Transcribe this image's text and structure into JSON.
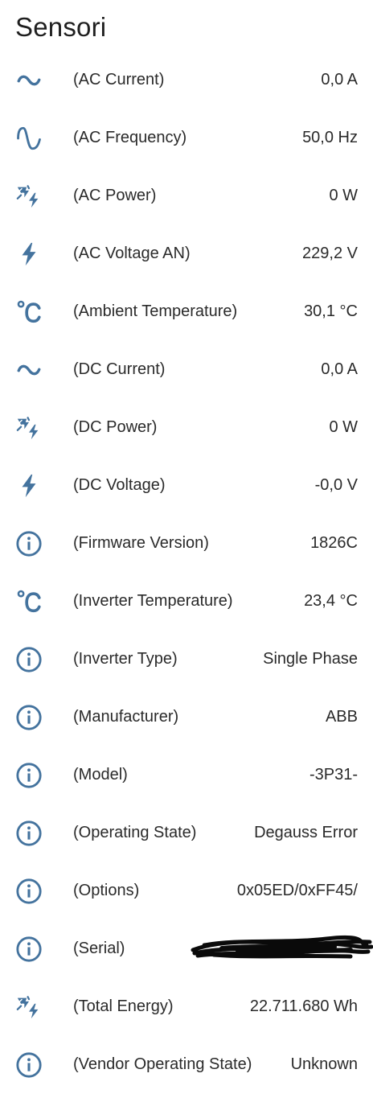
{
  "card": {
    "title": "Sensori",
    "accent_color": "#44739e"
  },
  "sensors": [
    {
      "icon": "current-ac-icon",
      "name": "(AC Current)",
      "value": "0,0 A"
    },
    {
      "icon": "sine-wave-icon",
      "name": "(AC Frequency)",
      "value": "50,0 Hz"
    },
    {
      "icon": "solar-power-icon",
      "name": "(AC Power)",
      "value": "0 W"
    },
    {
      "icon": "flash-icon",
      "name": "(AC Voltage AN)",
      "value": "229,2 V"
    },
    {
      "icon": "temperature-celsius-icon",
      "name": "(Ambient Temperature)",
      "value": "30,1 °C"
    },
    {
      "icon": "current-ac-icon",
      "name": "(DC Current)",
      "value": "0,0 A"
    },
    {
      "icon": "solar-power-icon",
      "name": "(DC Power)",
      "value": "0 W"
    },
    {
      "icon": "flash-icon",
      "name": "(DC Voltage)",
      "value": "-0,0 V"
    },
    {
      "icon": "information-outline-icon",
      "name": "(Firmware Version)",
      "value": "1826C"
    },
    {
      "icon": "temperature-celsius-icon",
      "name": "(Inverter Temperature)",
      "value": "23,4 °C"
    },
    {
      "icon": "information-outline-icon",
      "name": "(Inverter Type)",
      "value": "Single Phase"
    },
    {
      "icon": "information-outline-icon",
      "name": "(Manufacturer)",
      "value": "ABB"
    },
    {
      "icon": "information-outline-icon",
      "name": "(Model)",
      "value": "-3P31-"
    },
    {
      "icon": "information-outline-icon",
      "name": "(Operating State)",
      "value": "Degauss Error"
    },
    {
      "icon": "information-outline-icon",
      "name": "(Options)",
      "value": "0x05ED/0xFF45/"
    },
    {
      "icon": "information-outline-icon",
      "name": "(Serial)",
      "value": ""
    },
    {
      "icon": "solar-power-icon",
      "name": "(Total Energy)",
      "value": "22.711.680 Wh"
    },
    {
      "icon": "information-outline-icon",
      "name": "(Vendor Operating State)",
      "value": "Unknown"
    }
  ]
}
